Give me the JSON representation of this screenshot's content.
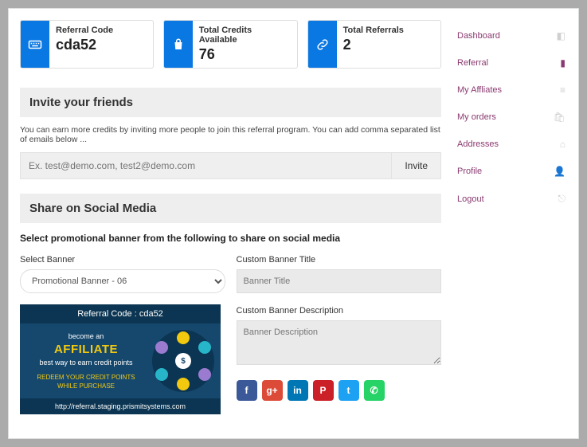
{
  "stats": {
    "referral": {
      "label": "Referral Code",
      "value": "cda52"
    },
    "credits": {
      "label": "Total Credits Available",
      "value": "76"
    },
    "referrals": {
      "label": "Total Referrals",
      "value": "2"
    }
  },
  "invite": {
    "heading": "Invite your friends",
    "desc": "You can earn more credits by inviting more people to join this referral program. You can add comma separated list of emails below ...",
    "placeholder": "Ex. test@demo.com, test2@demo.com",
    "button": "Invite"
  },
  "share": {
    "heading": "Share on Social Media",
    "sub": "Select promotional banner from the following to share on social media",
    "select_label": "Select Banner",
    "select_value": "Promotional Banner - 06",
    "title_label": "Custom Banner Title",
    "title_placeholder": "Banner Title",
    "desc_label": "Custom Banner Description",
    "desc_placeholder": "Banner Description"
  },
  "banner": {
    "code_line": "Referral Code : cda52",
    "line1": "become an",
    "line2": "AFFILIATE",
    "line3": "best way to earn credit points",
    "line4": "REDEEM YOUR CREDIT POINTS WHILE PURCHASE",
    "url": "http://referral.staging.prismitsystems.com"
  },
  "social": {
    "fb": "f",
    "gp": "g+",
    "li": "in",
    "pin": "P",
    "tw": "t",
    "wa": "✆"
  },
  "sidebar": {
    "items": [
      {
        "label": "Dashboard"
      },
      {
        "label": "Referral"
      },
      {
        "label": "My Affliates"
      },
      {
        "label": "My orders"
      },
      {
        "label": "Addresses"
      },
      {
        "label": "Profile"
      },
      {
        "label": "Logout"
      }
    ]
  },
  "colors": {
    "fb": "#3b5998",
    "gp": "#dc4a38",
    "li": "#0077b5",
    "pin": "#cb2027",
    "tw": "#1da1f2",
    "wa": "#25d366"
  }
}
